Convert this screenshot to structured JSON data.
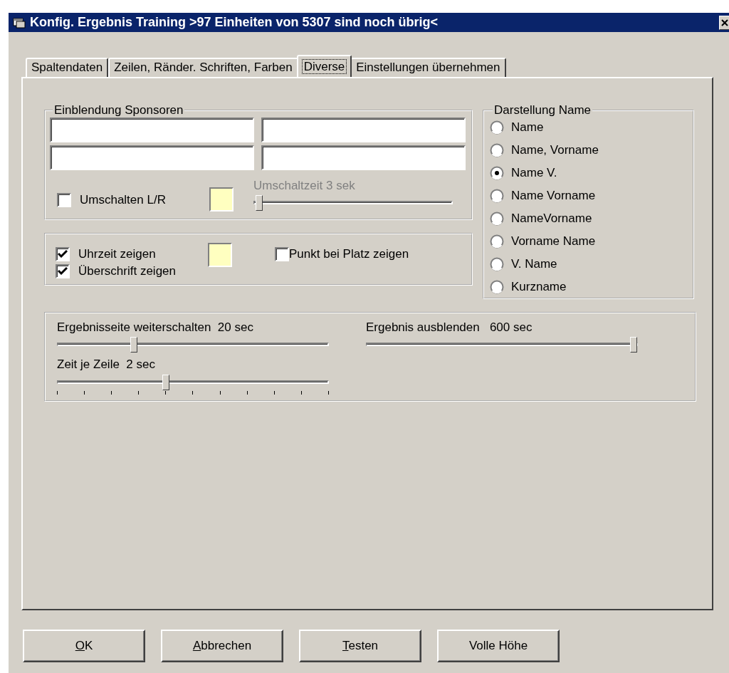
{
  "window": {
    "title": "Konfig. Ergebnis Training >97 Einheiten von 5307 sind noch übrig<"
  },
  "tabs": [
    {
      "label": "Spaltendaten",
      "selected": false
    },
    {
      "label": "Zeilen, Ränder. Schriften, Farben",
      "selected": false
    },
    {
      "label": "Diverse",
      "selected": true
    },
    {
      "label": "Einstellungen übernehmen",
      "selected": false
    }
  ],
  "sponsors": {
    "legend": "Einblendung Sponsoren",
    "fields": [
      {
        "kind": "text"
      },
      {
        "kind": "text"
      },
      {
        "kind": "text"
      },
      {
        "kind": "text"
      }
    ],
    "toggle": {
      "label": "Umschalten L/R",
      "checked": false
    },
    "swatch": {
      "color": "#ffffc0"
    },
    "slider": {
      "label": "Umschaltzeit 3 sek",
      "disabled": true,
      "level": 0.02
    }
  },
  "display": {
    "checks": [
      {
        "label": "Uhrzeit zeigen",
        "checked": true
      },
      {
        "label": "Überschrift zeigen",
        "checked": true
      },
      {
        "label": "Punkt bei Platz zeigen",
        "checked": false
      }
    ],
    "swatch": {
      "color": "#ffffc0"
    }
  },
  "name_format": {
    "legend": "Darstellung Name",
    "options": [
      {
        "label": "Name",
        "selected": false
      },
      {
        "label": "Name, Vorname",
        "selected": false
      },
      {
        "label": "Name V.",
        "selected": true
      },
      {
        "label": "Name Vorname",
        "selected": false
      },
      {
        "label": "NameVorname",
        "selected": false
      },
      {
        "label": "Vorname Name",
        "selected": false
      },
      {
        "label": "V. Name",
        "selected": false
      },
      {
        "label": "Kurzname",
        "selected": false
      }
    ]
  },
  "timing": {
    "sliders": [
      {
        "label": "Ergebnisseite weiterschalten  20 sec",
        "level": 0.28
      },
      {
        "label": "Ergebnis ausblenden   600 sec",
        "level": 0.99
      },
      {
        "label": "Zeit je Zeile  2 sec",
        "level": 0.4,
        "ticks": true
      }
    ]
  },
  "buttons": [
    {
      "label": "OK",
      "underline_first": true
    },
    {
      "label": "Abbrechen",
      "underline_first": true
    },
    {
      "label": "Testen",
      "underline_first": true
    },
    {
      "label": "Volle Höhe",
      "underline_first": false
    }
  ]
}
